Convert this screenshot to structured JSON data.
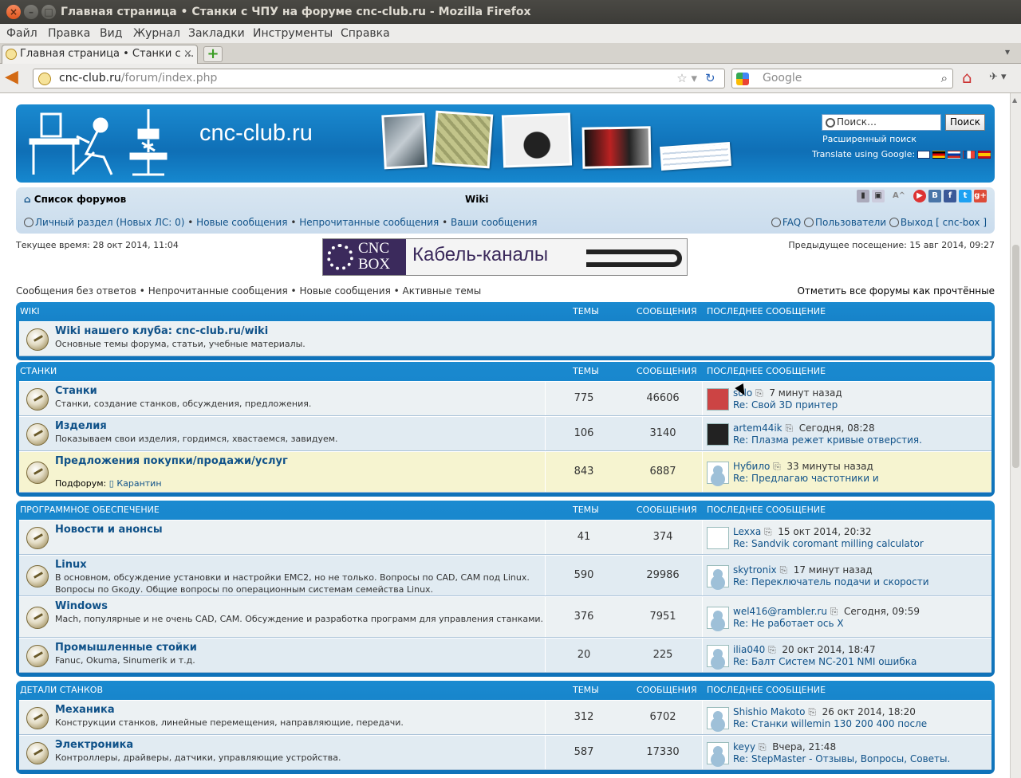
{
  "window": {
    "title": "Главная страница • Станки с ЧПУ на форуме cnc-club.ru - Mozilla Firefox"
  },
  "menu": [
    "Файл",
    "Правка",
    "Вид",
    "Журнал",
    "Закладки",
    "Инструменты",
    "Справка"
  ],
  "tab": {
    "label": "Главная страница • Станки с ..."
  },
  "address": {
    "domain": "cnc-club.ru",
    "path": "/forum/index.php"
  },
  "search": {
    "placeholder": "Google"
  },
  "header": {
    "site_name": "cnc-club.ru",
    "search_placeholder": "Поиск…",
    "search_button": "Поиск",
    "advanced_search": "Расширенный поиск",
    "translate": "Translate using Google:"
  },
  "nav": {
    "forum_list": "Список форумов",
    "wiki": "Wiki",
    "private": "Личный раздел (Новых ЛС: 0)",
    "new_posts": "Новые сообщения",
    "unread": "Непрочитанные сообщения",
    "your_posts": "Ваши сообщения",
    "faq": "FAQ",
    "users": "Пользователи",
    "logout": "Выход [ cnc-box ]"
  },
  "info": {
    "current_time": "Текущее время: 28 окт 2014, 11:04",
    "previous_visit": "Предыдущее посещение: 15 авг 2014, 09:27",
    "quick_links": "Сообщения без ответов • Непрочитанные сообщения • Новые сообщения • Активные темы",
    "mark_read": "Отметить все форумы как прочтённые"
  },
  "banner": {
    "logo_top": "CNC",
    "logo_bottom": "BOX",
    "text": "Кабель-каналы"
  },
  "columns": {
    "topics": "Темы",
    "posts": "Сообщения",
    "last_post": "Последнее сообщение"
  },
  "categories": [
    {
      "name": "Wiki",
      "forums": [
        {
          "title": "Wiki нашего клуба: cnc-club.ru/wiki",
          "desc": "Основные темы форума, статьи, учебные материалы.",
          "topics": "",
          "posts": "",
          "author": "",
          "time": "",
          "last": ""
        }
      ]
    },
    {
      "name": "Станки",
      "forums": [
        {
          "title": "Станки",
          "desc": "Станки, создание станков, обсуждения, предложения.",
          "topics": "775",
          "posts": "46606",
          "author": "solo",
          "time": "7 минут назад",
          "last": "Re: Свой 3D принтер"
        },
        {
          "title": "Изделия",
          "desc": "Показываем свои изделия, гордимся, хвастаемся, завидуем.",
          "topics": "106",
          "posts": "3140",
          "author": "artem44ik",
          "time": "Сегодня, 08:28",
          "last": "Re: Плазма режет кривые отверстия."
        },
        {
          "title": "Предложения покупки/продажи/услуг",
          "desc": "",
          "subforum_label": "Подфорум:",
          "subforum": "Карантин",
          "topics": "843",
          "posts": "6887",
          "author": "Нубило",
          "time": "33 минуты назад",
          "last": "Re: Предлагаю частотники и"
        }
      ]
    },
    {
      "name": "Программное обеспечение",
      "forums": [
        {
          "title": "Новости и анонсы",
          "desc": "",
          "topics": "41",
          "posts": "374",
          "author": "Lexxa",
          "time": "15 окт 2014, 20:32",
          "last": "Re: Sandvik coromant milling calculator"
        },
        {
          "title": "Linux",
          "desc": "В основном, обсуждение установки и настройки EMC2, но не только. Вопросы по CAD, CAM под Linux. Вопросы по Gкоду. Общие вопросы по операционным системам семейства Linux.",
          "topics": "590",
          "posts": "29986",
          "author": "skytronix",
          "time": "17 минут назад",
          "last": "Re: Переключатель подачи и скорости"
        },
        {
          "title": "Windows",
          "desc": "Mach, популярные и не очень CAD, CAM. Обсуждение и разработка программ для управления станками.",
          "topics": "376",
          "posts": "7951",
          "author": "wel416@rambler.ru",
          "time": "Сегодня, 09:59",
          "last": "Re: Не работает ось X"
        },
        {
          "title": "Промышленные стойки",
          "desc": "Fanuc, Okuma, Sinumerik и т.д.",
          "topics": "20",
          "posts": "225",
          "author": "ilia040",
          "time": "20 окт 2014, 18:47",
          "last": "Re: Балт Систем NC-201 NMI ошибка"
        }
      ]
    },
    {
      "name": "Детали станков",
      "forums": [
        {
          "title": "Механика",
          "desc": "Конструкции станков, линейные перемещения, направляющие, передачи.",
          "topics": "312",
          "posts": "6702",
          "author": "Shishio Makoto",
          "time": "26 окт 2014, 18:20",
          "last": "Re: Станки willemin 130 200 400 после"
        },
        {
          "title": "Электроника",
          "desc": "Контроллеры, драйверы, датчики, управляющие устройства.",
          "topics": "587",
          "posts": "17330",
          "author": "keyy",
          "time": "Вчера, 21:48",
          "last": "Re: StepMaster - Отзывы, Вопросы, Советы."
        }
      ]
    }
  ]
}
